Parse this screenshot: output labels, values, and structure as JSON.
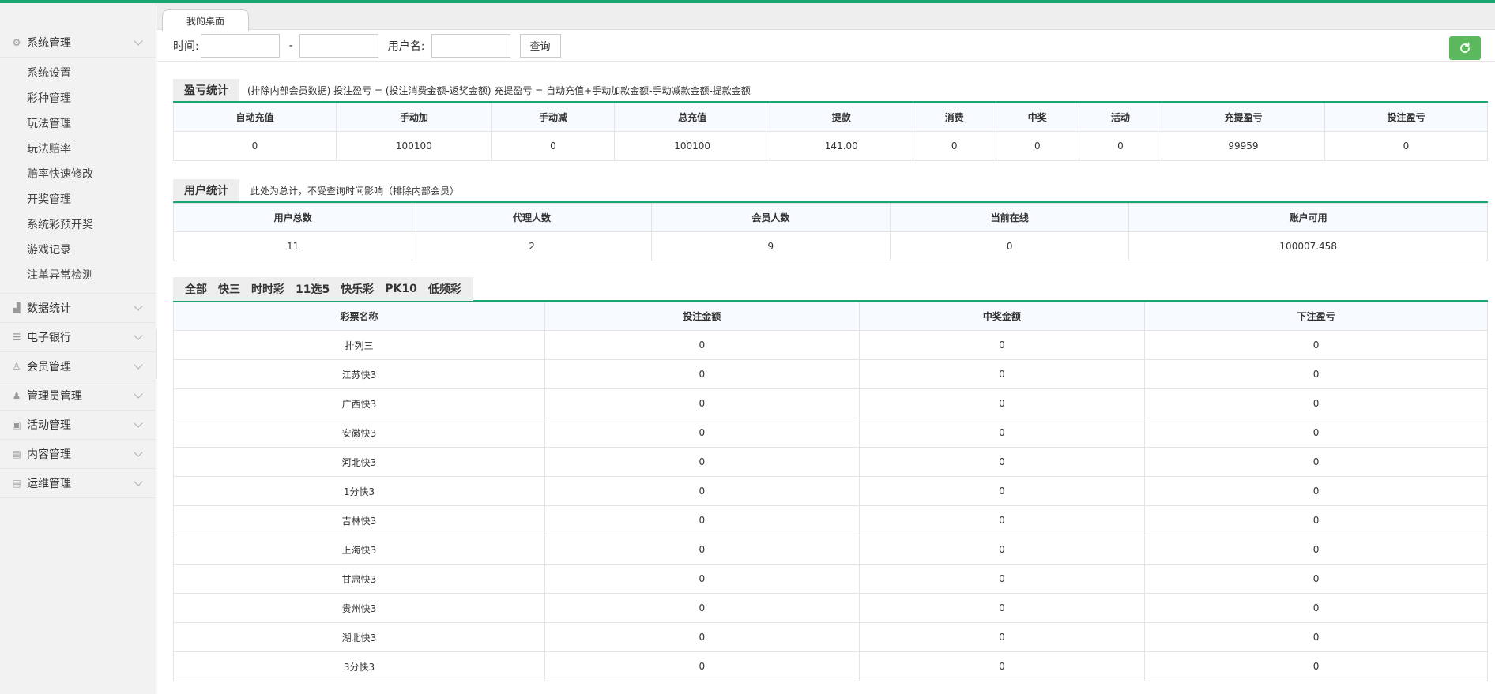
{
  "sidebar": {
    "groups": [
      {
        "label": "系统管理",
        "icon": "gear-icon",
        "items": [
          "系统设置",
          "彩种管理",
          "玩法管理",
          "玩法赔率",
          "赔率快速修改",
          "开奖管理",
          "系统彩预开奖",
          "游戏记录",
          "注单异常检测"
        ]
      },
      {
        "label": "数据统计",
        "icon": "chart-icon"
      },
      {
        "label": "电子银行",
        "icon": "list-icon"
      },
      {
        "label": "会员管理",
        "icon": "user-outline-icon"
      },
      {
        "label": "管理员管理",
        "icon": "user-icon"
      },
      {
        "label": "活动管理",
        "icon": "gift-icon"
      },
      {
        "label": "内容管理",
        "icon": "building-icon"
      },
      {
        "label": "运维管理",
        "icon": "building-icon"
      }
    ]
  },
  "tabs": {
    "desktop": "我的桌面"
  },
  "filter": {
    "time_label": "时间:",
    "dash": "-",
    "username_label": "用户名:",
    "query_label": "查询"
  },
  "profit": {
    "title": "盈亏统计",
    "note": "(排除内部会员数据)  投注盈亏 = (投注消费金额-返奖金额)    充提盈亏 = 自动充值+手动加款金额-手动减款金额-提款金额",
    "headers": [
      "自动充值",
      "手动加",
      "手动减",
      "总充值",
      "提款",
      "消费",
      "中奖",
      "活动",
      "充提盈亏",
      "投注盈亏"
    ],
    "values": [
      "0",
      "100100",
      "0",
      "100100",
      "141.00",
      "0",
      "0",
      "0",
      "99959",
      "0"
    ]
  },
  "users": {
    "title": "用户统计",
    "note": "此处为总计，不受查询时间影响（排除内部会员）",
    "headers": [
      "用户总数",
      "代理人数",
      "会员人数",
      "当前在线",
      "账户可用"
    ],
    "values": [
      "11",
      "2",
      "9",
      "0",
      "100007.458"
    ]
  },
  "lottery": {
    "tabs": [
      "全部",
      "快三",
      "时时彩",
      "11选5",
      "快乐彩",
      "PK10",
      "低频彩"
    ],
    "headers": [
      "彩票名称",
      "投注金额",
      "中奖金额",
      "下注盈亏"
    ],
    "rows": [
      [
        "排列三",
        "0",
        "0",
        "0"
      ],
      [
        "江苏快3",
        "0",
        "0",
        "0"
      ],
      [
        "广西快3",
        "0",
        "0",
        "0"
      ],
      [
        "安徽快3",
        "0",
        "0",
        "0"
      ],
      [
        "河北快3",
        "0",
        "0",
        "0"
      ],
      [
        "1分快3",
        "0",
        "0",
        "0"
      ],
      [
        "吉林快3",
        "0",
        "0",
        "0"
      ],
      [
        "上海快3",
        "0",
        "0",
        "0"
      ],
      [
        "甘肃快3",
        "0",
        "0",
        "0"
      ],
      [
        "贵州快3",
        "0",
        "0",
        "0"
      ],
      [
        "湖北快3",
        "0",
        "0",
        "0"
      ],
      [
        "3分快3",
        "0",
        "0",
        "0"
      ]
    ]
  }
}
